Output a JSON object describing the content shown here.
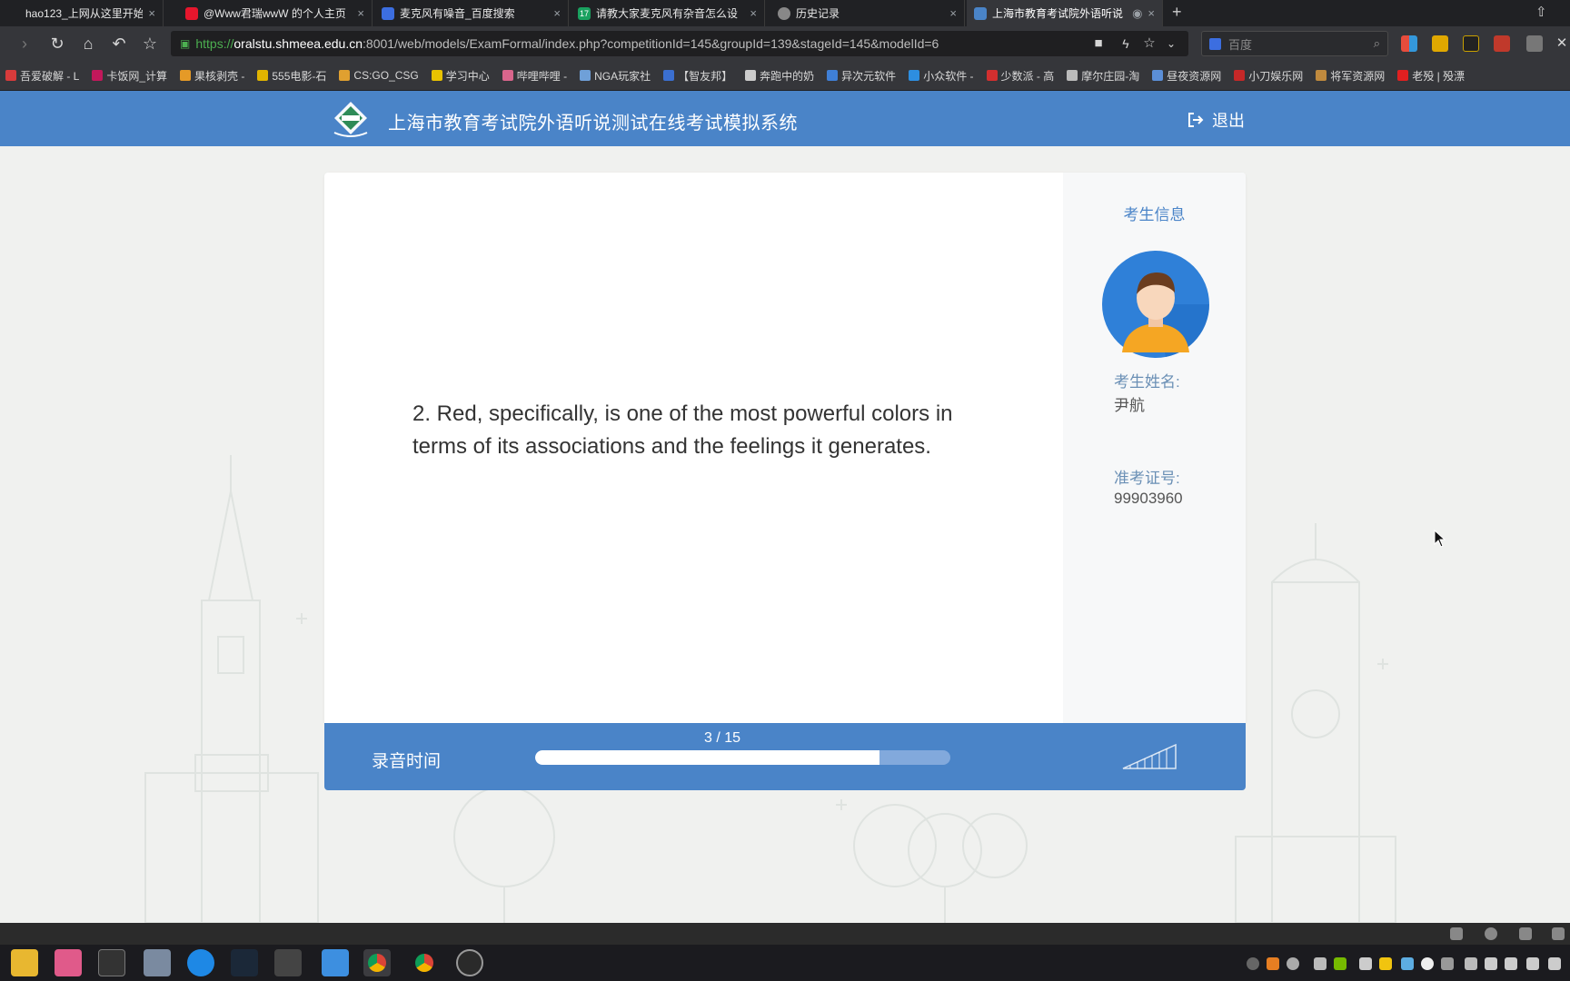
{
  "browser": {
    "tabs": [
      {
        "title": "hao123_上网从这里开始",
        "icon": "hao123-icon",
        "color": "#e23d2d"
      },
      {
        "title": "@Www君瑞wwW 的个人主页",
        "icon": "weibo-icon",
        "color": "#e6162d"
      },
      {
        "title": "麦克风有噪音_百度搜索",
        "icon": "baidu-icon",
        "color": "#3c6ee0"
      },
      {
        "title": "请教大家麦克风有杂音怎么设",
        "icon": "17-icon",
        "color": "#19a15f"
      },
      {
        "title": "历史记录",
        "icon": "clock-icon",
        "color": "#888888"
      },
      {
        "title": "上海市教育考试院外语听说",
        "icon": "exam-icon",
        "color": "#4a84c8"
      }
    ],
    "url": {
      "protocol": "https://",
      "host": "oralstu.shmeea.edu.cn",
      "rest": ":8001/web/models/ExamFormal/index.php?competitionId=145&groupId=139&stageId=145&modelId=6"
    },
    "search_placeholder": "百度",
    "bookmarks": [
      {
        "label": "吾爱破解 - L",
        "color": "#d83b3b"
      },
      {
        "label": "卡饭网_计算",
        "color": "#c2185b"
      },
      {
        "label": "果核剥壳 -",
        "color": "#e59a27"
      },
      {
        "label": "555电影-石",
        "color": "#e0b400"
      },
      {
        "label": "CS:GO_CSG",
        "color": "#e0a030"
      },
      {
        "label": "学习中心",
        "color": "#e8c200"
      },
      {
        "label": "哔哩哔哩 -",
        "color": "#d9658c"
      },
      {
        "label": "NGA玩家社",
        "color": "#6fa0d8"
      },
      {
        "label": "【智友邦】",
        "color": "#3b6fd0"
      },
      {
        "label": "奔跑中的奶",
        "color": "#cccccc"
      },
      {
        "label": "异次元软件",
        "color": "#3f7fd6"
      },
      {
        "label": "小众软件 -",
        "color": "#2d8ee0"
      },
      {
        "label": "少数派 - 高",
        "color": "#d32f2f"
      },
      {
        "label": "摩尔庄园-淘",
        "color": "#bbbbbb"
      },
      {
        "label": "昼夜资源网",
        "color": "#5b8fd8"
      },
      {
        "label": "小刀娱乐网",
        "color": "#c62828"
      },
      {
        "label": "将军资源网",
        "color": "#c08a3e"
      },
      {
        "label": "老殁 | 殁漂",
        "color": "#e02020"
      }
    ]
  },
  "app": {
    "title": "上海市教育考试院外语听说测试在线考试模拟系统",
    "logout_label": "退出"
  },
  "exam": {
    "question_text": "2. Red, specifically, is one of the most powerful colors in terms of its associations and the feelings it generates."
  },
  "candidate": {
    "panel_title": "考生信息",
    "name_label": "考生姓名:",
    "name_value": "尹航",
    "id_label": "准考证号:",
    "id_value": "99903960"
  },
  "recording": {
    "label": "录音时间",
    "counter": "3 / 15",
    "progress_fraction": 0.83
  },
  "colors": {
    "brand_blue": "#4a84c8",
    "progress_track": "#82a9dc"
  }
}
